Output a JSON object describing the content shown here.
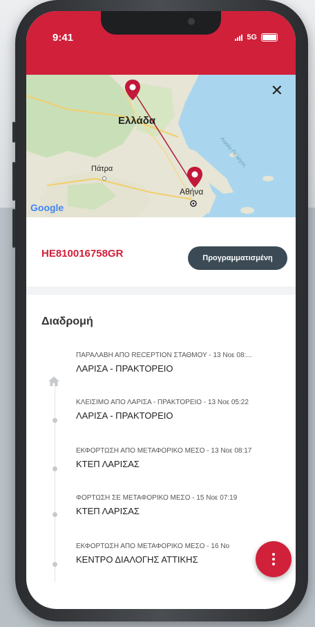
{
  "status_bar": {
    "time": "9:41",
    "network": "5G"
  },
  "map": {
    "country_label": "Ελλάδα",
    "city_patra": "Πάτρα",
    "city_athens": "Αθήνα",
    "sea_label": "Αιγαίο Πέλαγος",
    "attribution": "Google",
    "route_color": "#b01a32"
  },
  "shipment": {
    "tracking_number": "HE810016758GR",
    "status": "Προγραμματισμένη"
  },
  "route": {
    "title": "Διαδρομή",
    "events": [
      {
        "subtitle": "ΠΑΡΑΛΑΒΗ ΑΠΟ RECEPTION ΣΤΑΘΜΟΥ - 13 Νοε 08:...",
        "location": "ΛΑΡΙΣΑ - ΠΡΑΚΤΟΡΕΙΟ",
        "icon": "home-icon"
      },
      {
        "subtitle": "ΚΛΕΙΣΙΜΟ ΑΠΟ  ΛΑΡΙΣΑ - ΠΡΑΚΤΟΡΕΙΟ - 13 Νοε 05:22",
        "location": "ΛΑΡΙΣΑ - ΠΡΑΚΤΟΡΕΙΟ",
        "icon": "dot"
      },
      {
        "subtitle": "ΕΚΦΟΡΤΩΣΗ ΑΠΟ ΜΕΤΑΦΟΡΙΚΟ ΜΕΣΟ - 13 Νοε 08:17",
        "location": "ΚΤΕΠ ΛΑΡΙΣΑΣ",
        "icon": "dot"
      },
      {
        "subtitle": "ΦΟΡΤΩΣΗ ΣΕ ΜΕΤΑΦΟΡΙΚΟ ΜΕΣΟ - 15 Νοε 07:19",
        "location": "ΚΤΕΠ ΛΑΡΙΣΑΣ",
        "icon": "dot"
      },
      {
        "subtitle": "ΕΚΦΟΡΤΩΣΗ ΑΠΟ ΜΕΤΑΦΟΡΙΚΟ ΜΕΣΟ - 16 Νο",
        "location": "ΚΕΝΤΡΟ ΔΙΑΛΟΓΗΣ ΑΤΤΙΚΗΣ",
        "icon": "dot"
      }
    ]
  },
  "colors": {
    "brand": "#d0203a",
    "pill": "#3b4a55"
  }
}
